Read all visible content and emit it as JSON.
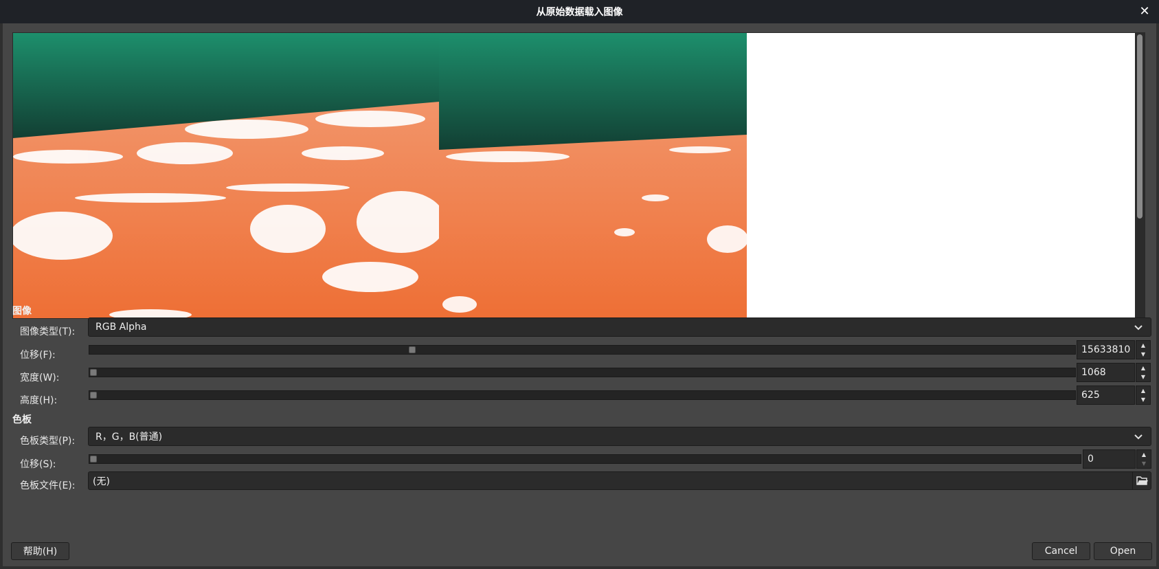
{
  "window": {
    "title": "从原始数据载入图像",
    "close_icon": "close-icon"
  },
  "image_section": {
    "heading": "图像",
    "type_label": "图像类型(T):",
    "type_value": "RGB Alpha",
    "offset_label": "位移(F):",
    "offset_value": "15633810",
    "width_label": "宽度(W):",
    "width_value": "1068",
    "height_label": "高度(H):",
    "height_value": "625"
  },
  "palette_section": {
    "heading": "色板",
    "type_label": "色板类型(P):",
    "type_value": "R，G，B(普通)",
    "offset_label": "位移(S):",
    "offset_value": "0",
    "file_label": "色板文件(E):",
    "file_value": "(无)"
  },
  "buttons": {
    "help": "帮助(H)",
    "cancel": "Cancel",
    "open": "Open"
  },
  "colors": {
    "teal": "#1f8a6a",
    "orange": "#ef7a44",
    "panel": "#464646"
  }
}
